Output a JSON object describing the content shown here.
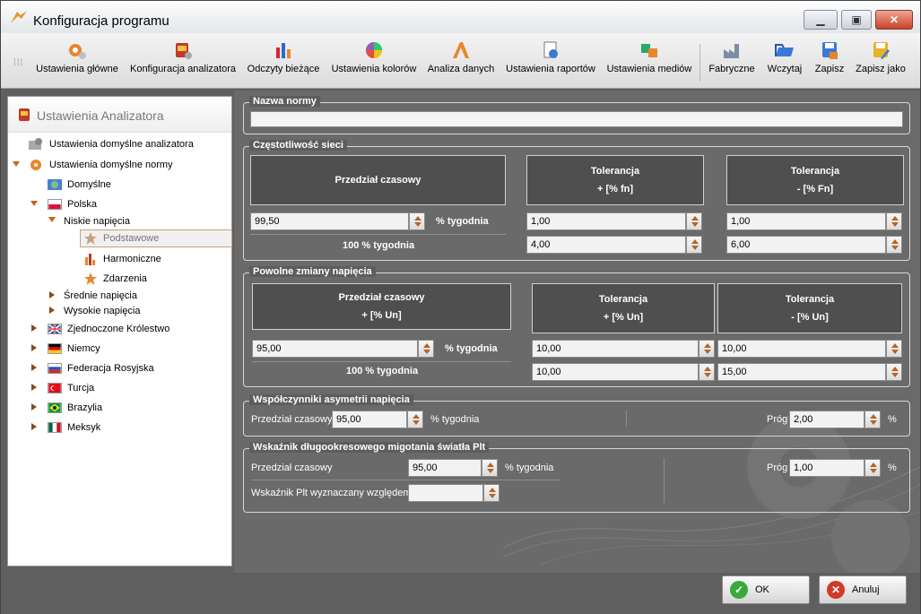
{
  "window": {
    "title": "Konfiguracja programu"
  },
  "toolbar": {
    "items": [
      {
        "label": "Ustawienia główne",
        "icon": "gears-icon"
      },
      {
        "label": "Konfiguracja analizatora",
        "icon": "analyzer-icon"
      },
      {
        "label": "Odczyty bieżące",
        "icon": "bars-chart-icon"
      },
      {
        "label": "Ustawienia kolorów",
        "icon": "color-wheel-icon"
      },
      {
        "label": "Analiza danych",
        "icon": "data-analysis-icon"
      },
      {
        "label": "Ustawienia raportów",
        "icon": "report-icon"
      },
      {
        "label": "Ustawienia mediów",
        "icon": "media-icon"
      },
      {
        "label": "Fabryczne",
        "icon": "factory-icon"
      },
      {
        "label": "Wczytaj",
        "icon": "load-icon"
      },
      {
        "label": "Zapisz",
        "icon": "save-icon"
      },
      {
        "label": "Zapisz jako",
        "icon": "save-as-icon"
      }
    ]
  },
  "sidebar": {
    "title": "Ustawienia Analizatora",
    "items": [
      {
        "label": "Ustawienia domyślne analizatora"
      },
      {
        "label": "Ustawienia domyślne normy"
      },
      {
        "label": "Domyślne"
      },
      {
        "label": "Polska"
      },
      {
        "label": "Niskie napięcia"
      },
      {
        "label": "Podstawowe"
      },
      {
        "label": "Harmoniczne"
      },
      {
        "label": "Zdarzenia"
      },
      {
        "label": "Średnie napięcia"
      },
      {
        "label": "Wysokie napięcia"
      },
      {
        "label": "Zjednoczone Królestwo"
      },
      {
        "label": "Niemcy"
      },
      {
        "label": "Federacja Rosyjska"
      },
      {
        "label": "Turcja"
      },
      {
        "label": "Brazylia"
      },
      {
        "label": "Meksyk"
      }
    ]
  },
  "norm_name": {
    "label": "Nazwa normy",
    "value": ""
  },
  "frequency": {
    "label": "Częstotliwość sieci",
    "col1_header": "Przedział czasowy",
    "col2_header_1": "Tolerancja",
    "col2_header_2": "+ [% fn]",
    "col3_header_1": "Tolerancja",
    "col3_header_2": "- [% Fn]",
    "period_value": "99,50",
    "period_unit": "%  tygodnia",
    "full_period": "100 % tygodnia",
    "tol_plus_1": "1,00",
    "tol_plus_2": "4,00",
    "tol_minus_1": "1,00",
    "tol_minus_2": "6,00"
  },
  "slow_voltage": {
    "label": "Powolne zmiany napięcia",
    "col1_header_1": "Przedział czasowy",
    "col1_header_2": "+ [% Un]",
    "col2_header_1": "Tolerancja",
    "col2_header_2": "+ [% Un]",
    "col3_header_1": "Tolerancja",
    "col3_header_2": "- [% Un]",
    "period_value": "95,00",
    "period_unit": "% tygodnia",
    "full_period": "100 % tygodnia",
    "tol_plus_1": "10,00",
    "tol_plus_2": "10,00",
    "tol_minus_1": "10,00",
    "tol_minus_2": "15,00"
  },
  "asymmetry": {
    "label": "Współczynniki asymetrii napięcia",
    "period_label": "Przedział czasowy",
    "period_value": "95,00",
    "period_unit": "%  tygodnia",
    "threshold_label": "Próg",
    "threshold_value": "2,00",
    "threshold_unit": "%"
  },
  "plt": {
    "label": "Wskaźnik długookresowego migotania światła Plt",
    "period_label": "Przedział czasowy",
    "period_value": "95,00",
    "period_unit": "%  tygodnia",
    "relative_label": "Wskaźnik Plt wyznaczany względem",
    "relative_value": "",
    "threshold_label": "Próg",
    "threshold_value": "1,00",
    "threshold_unit": "%"
  },
  "footer": {
    "ok_label": "OK",
    "cancel_label": "Anuluj"
  }
}
